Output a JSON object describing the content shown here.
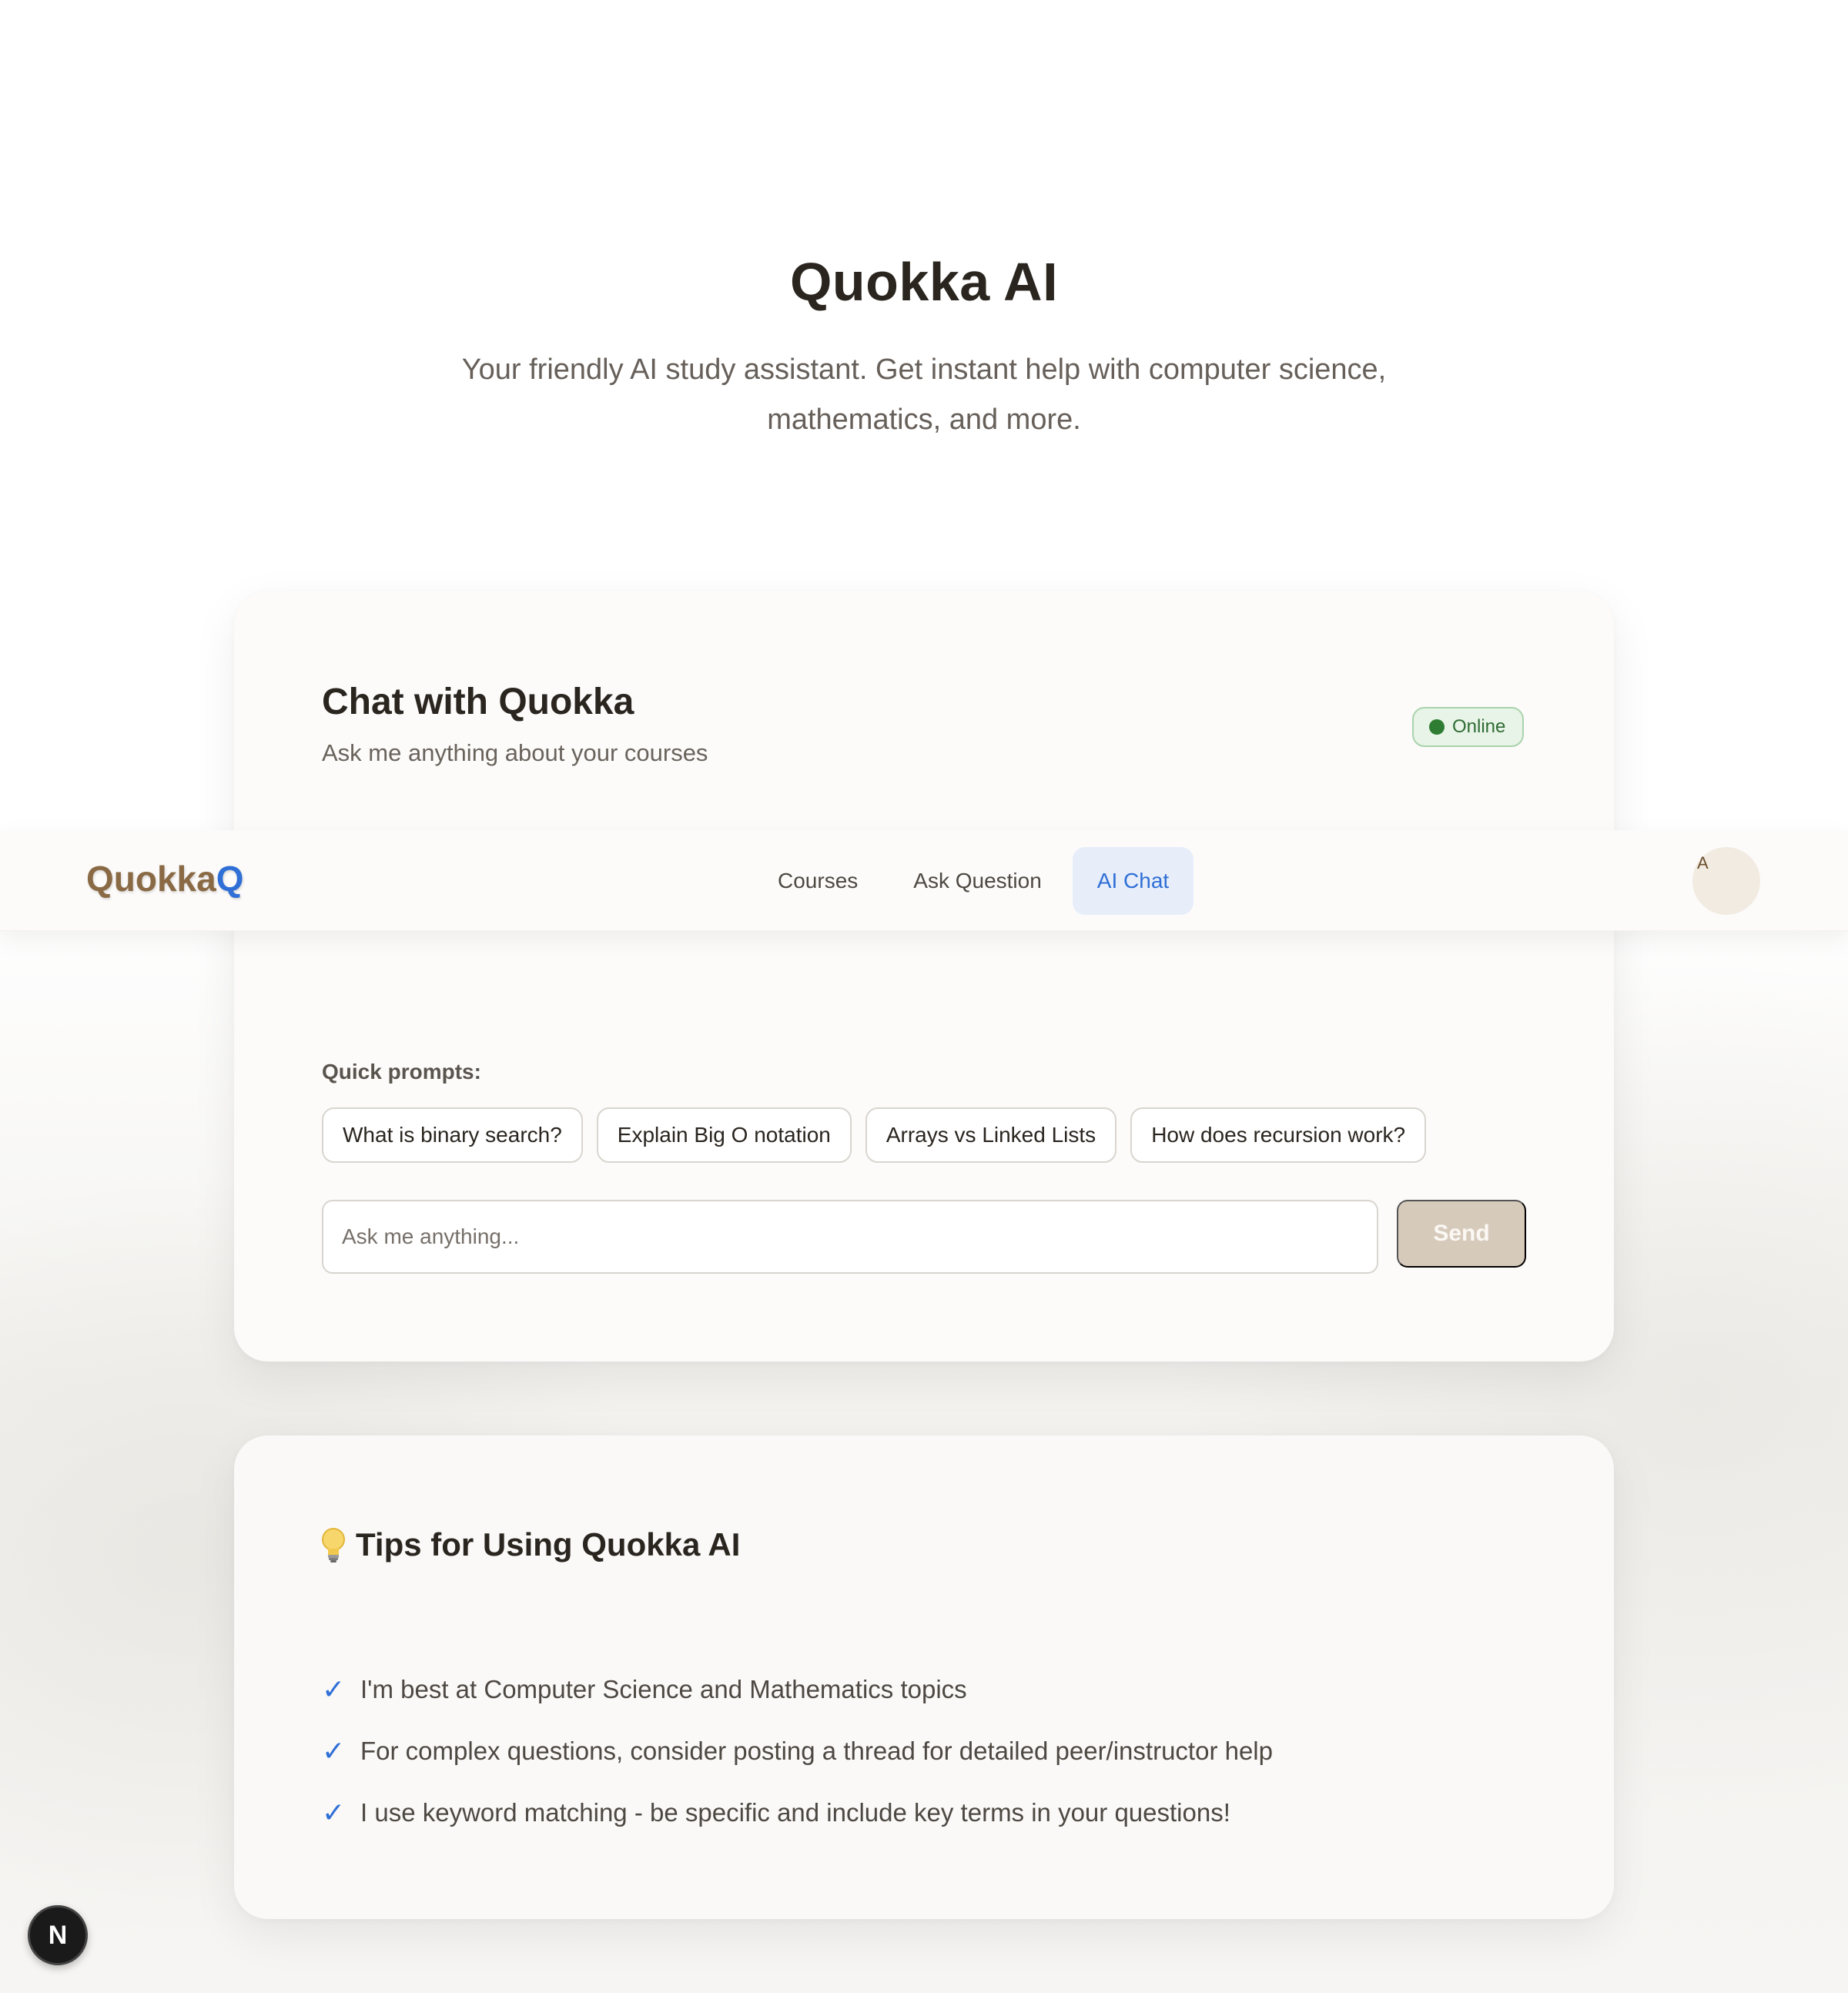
{
  "hero": {
    "title": "Quokka AI",
    "subtitle": "Your friendly AI study assistant. Get instant help with computer science, mathematics, and more."
  },
  "chat": {
    "title": "Chat with Quokka",
    "subtitle": "Ask me anything about your courses",
    "status": "Online",
    "quick_prompts_label": "Quick prompts:",
    "quick_prompts": [
      "What is binary search?",
      "Explain Big O notation",
      "Arrays vs Linked Lists",
      "How does recursion work?"
    ],
    "input_placeholder": "Ask me anything...",
    "send_label": "Send"
  },
  "tips": {
    "title": "Tips for Using Quokka AI",
    "items": [
      "I'm best at Computer Science and Mathematics topics",
      "For complex questions, consider posting a thread for detailed peer/instructor help",
      "I use keyword matching - be specific and include key terms in your questions!"
    ]
  },
  "navbar": {
    "logo_text": "Quokka",
    "logo_accent": "Q",
    "links": [
      "Courses",
      "Ask Question",
      "AI Chat"
    ],
    "active_link": "AI Chat",
    "avatar_initial": "A"
  },
  "dev_badge": "N",
  "colors": {
    "accent_blue": "#2f6fd6",
    "brand_brown": "#8a6a45",
    "online_green": "#2e7d32",
    "send_disabled": "#d6cabb"
  },
  "icons": {
    "tips_icon": "lightbulb-icon",
    "tip_bullet": "check-icon",
    "status_indicator": "status-dot-icon"
  }
}
